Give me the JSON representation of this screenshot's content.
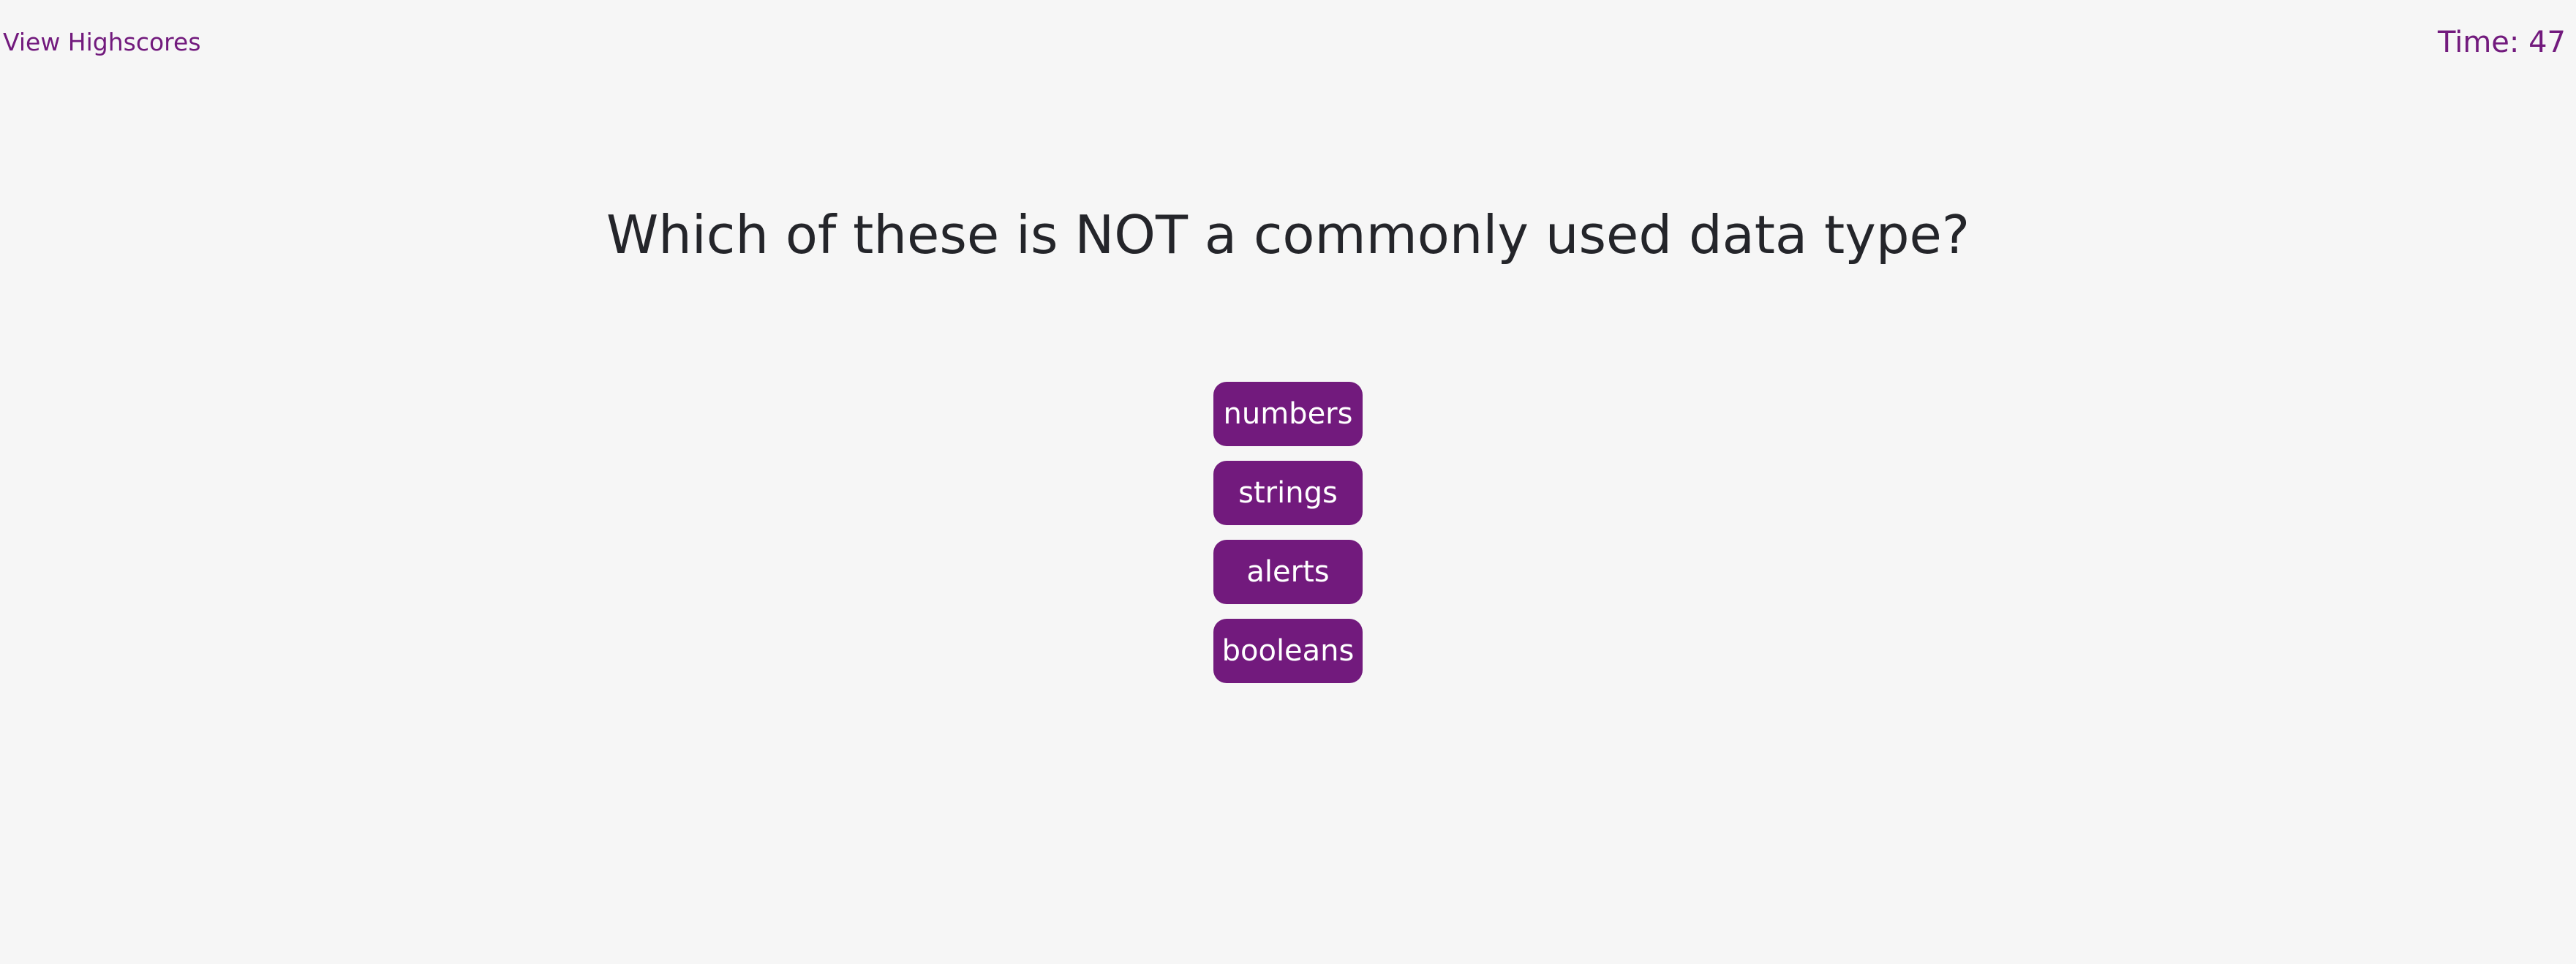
{
  "header": {
    "highscores_label": "View Highscores",
    "timer_label": "Time: 47"
  },
  "quiz": {
    "question": "Which of these is NOT a commonly used data type?",
    "answers": [
      {
        "label": "numbers"
      },
      {
        "label": "strings"
      },
      {
        "label": "alerts"
      },
      {
        "label": "booleans"
      }
    ]
  },
  "colors": {
    "accent": "#721a7d",
    "background": "#f6f6f6",
    "text": "#24252a",
    "button_text": "#ffffff"
  }
}
